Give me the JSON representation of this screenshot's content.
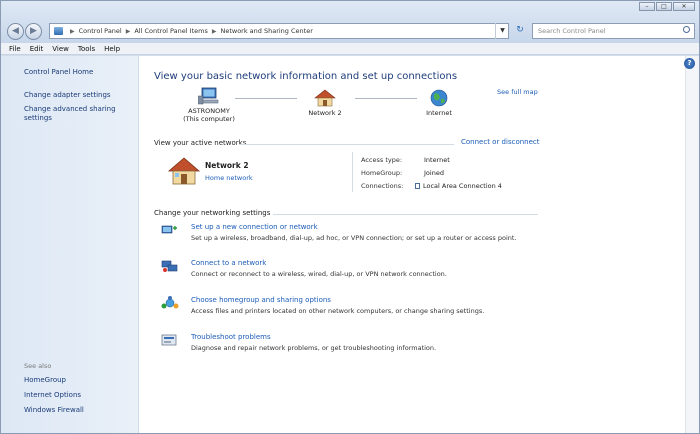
{
  "address_bar": {
    "crumbs": [
      "Control Panel",
      "All Control Panel Items",
      "Network and Sharing Center"
    ]
  },
  "search": {
    "placeholder": "Search Control Panel"
  },
  "menu": [
    "File",
    "Edit",
    "View",
    "Tools",
    "Help"
  ],
  "left_pane": {
    "home": "Control Panel Home",
    "links": [
      "Change adapter settings",
      "Change advanced sharing settings"
    ],
    "see_also_heading": "See also",
    "see_also": [
      "HomeGroup",
      "Internet Options",
      "Windows Firewall"
    ]
  },
  "main": {
    "title": "View your basic network information and set up connections",
    "see_full_map": "See full map",
    "map": {
      "computer_name": "ASTRONOMY",
      "computer_sub": "(This computer)",
      "network": "Network  2",
      "internet": "Internet"
    },
    "active_networks": {
      "heading": "View your active networks",
      "connect_link": "Connect or disconnect",
      "network_name": "Network  2",
      "network_type": "Home network",
      "access_type_label": "Access type:",
      "access_type_value": "Internet",
      "homegroup_label": "HomeGroup:",
      "homegroup_value": "Joined",
      "connections_label": "Connections:",
      "connections_value": "Local Area Connection 4"
    },
    "settings": {
      "heading": "Change your networking settings",
      "tasks": [
        {
          "link": "Set up a new connection or network",
          "desc": "Set up a wireless, broadband, dial-up, ad hoc, or VPN connection; or set up a router or access point."
        },
        {
          "link": "Connect to a network",
          "desc": "Connect or reconnect to a wireless, wired, dial-up, or VPN network connection."
        },
        {
          "link": "Choose homegroup and sharing options",
          "desc": "Access files and printers located on other network computers, or change sharing settings."
        },
        {
          "link": "Troubleshoot problems",
          "desc": "Diagnose and repair network problems, or get troubleshooting information."
        }
      ]
    }
  },
  "colors": {
    "link": "#1b5cb8",
    "title": "#1e3d7b",
    "pane": "#dde8f5"
  }
}
